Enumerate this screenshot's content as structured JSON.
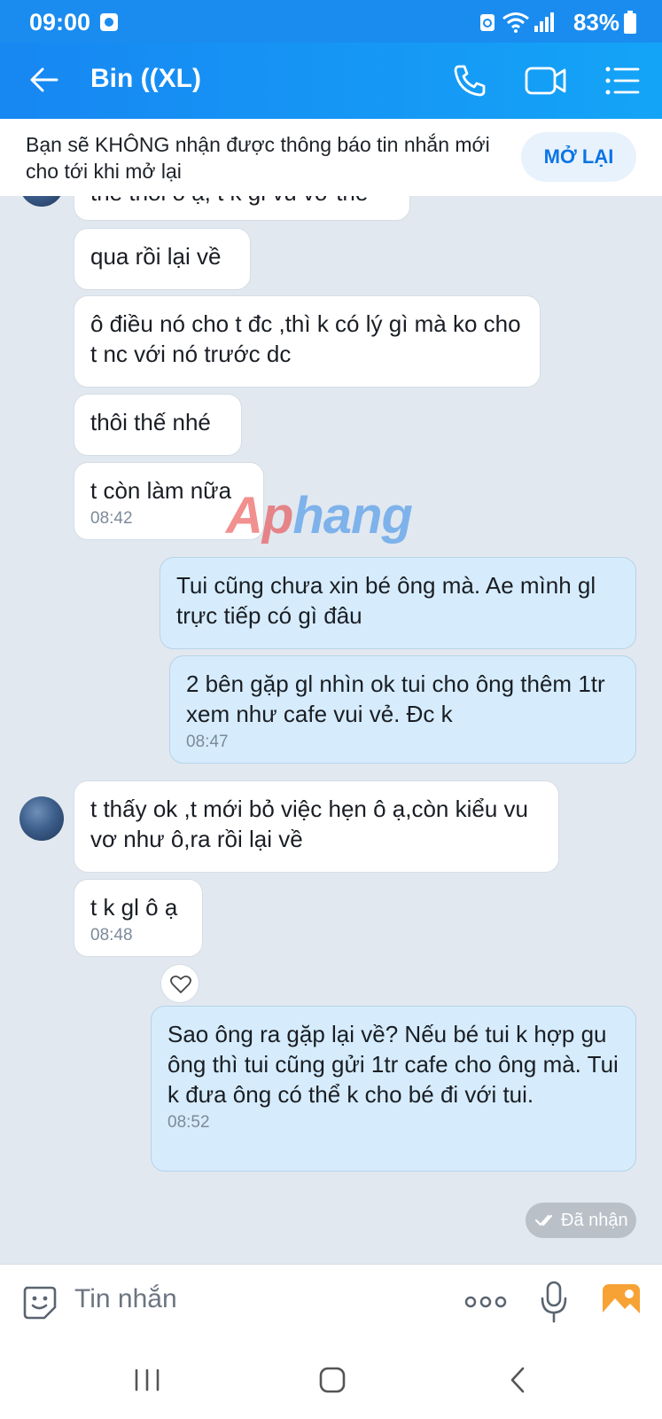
{
  "status_bar": {
    "time": "09:00",
    "battery": "83%"
  },
  "header": {
    "title": "Bin ((XL)",
    "back_icon": "arrow-left-icon",
    "call_icon": "phone-icon",
    "video_icon": "video-camera-icon",
    "menu_icon": "list-menu-icon"
  },
  "notice": {
    "text": "Bạn sẽ KHÔNG nhận được thông báo tin nhắn mới cho tới khi mở lại",
    "button": "MỞ LẠI"
  },
  "messages": {
    "m0": {
      "text": "thế thôi ô ạ, t k gl vu vơ thế"
    },
    "m1": {
      "text": "qua rồi lại về"
    },
    "m2": {
      "text": "ô điều nó cho t đc ,thì k có lý gì mà ko cho t nc với nó trước dc"
    },
    "m3": {
      "text": "thôi thế nhé"
    },
    "m4": {
      "text": "t còn làm nữa",
      "time": "08:42"
    },
    "m5": {
      "text": "Tui cũng chưa xin bé ông mà. Ae mình gl trực tiếp có gì đâu"
    },
    "m6": {
      "text": "2 bên gặp gl nhìn ok tui cho ông thêm 1tr xem như cafe vui vẻ. Đc k",
      "time": "08:47"
    },
    "m7": {
      "text": "t thấy ok ,t mới bỏ việc hẹn ô ạ,còn kiểu vu vơ như ô,ra rồi lại về"
    },
    "m8": {
      "text": "t k gl ô ạ",
      "time": "08:48"
    },
    "m9": {
      "text": "Sao ông ra gặp lại về? Nếu bé tui k hợp gu ông thì tui cũng gửi 1tr cafe cho ông mà. Tui k đưa ông có thể k cho bé đi với tui.",
      "time": "08:52"
    },
    "received_status": "Đã nhận"
  },
  "watermark": {
    "part1": "Ap",
    "part2": "hang"
  },
  "composer": {
    "placeholder": "Tin nhắn",
    "sticker_icon": "sticker-face-icon",
    "more_icon": "more-dots-icon",
    "mic_icon": "microphone-icon",
    "image_icon": "image-gallery-icon"
  },
  "nav": {
    "recents_icon": "recents-icon",
    "home_icon": "home-icon",
    "back_icon": "back-chevron-icon"
  }
}
